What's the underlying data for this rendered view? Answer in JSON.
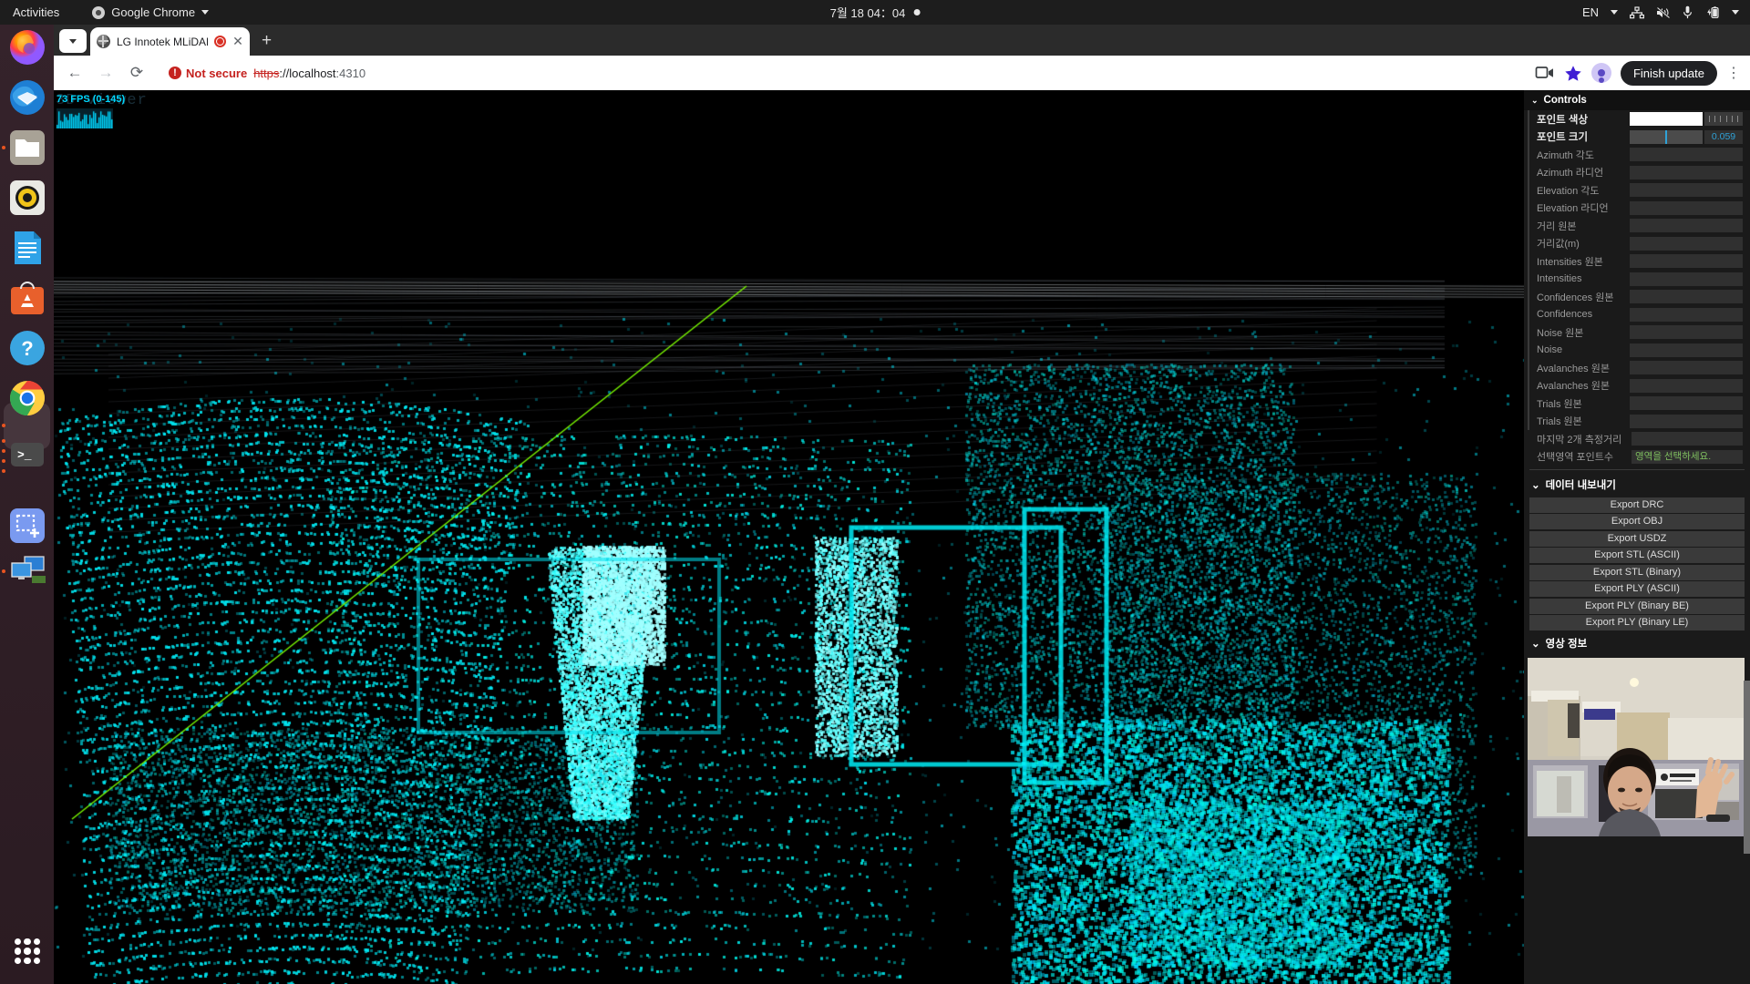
{
  "desktop": {
    "activities": "Activities",
    "app_menu": "Google Chrome",
    "clock": "7월 18  04：04",
    "tray": {
      "language": "EN"
    },
    "dock_items": [
      {
        "name": "firefox",
        "label": "Firefox"
      },
      {
        "name": "thunderbird",
        "label": "Thunderbird"
      },
      {
        "name": "files",
        "label": "Files"
      },
      {
        "name": "rhythmbox",
        "label": "Rhythmbox"
      },
      {
        "name": "libreoffice-writer",
        "label": "LibreOffice Writer"
      },
      {
        "name": "ubuntu-software",
        "label": "Ubuntu Software"
      },
      {
        "name": "help",
        "label": "Help"
      },
      {
        "name": "google-chrome",
        "label": "Google Chrome"
      },
      {
        "name": "terminal",
        "label": "Terminal"
      },
      {
        "name": "screenshot",
        "label": "Screenshot"
      },
      {
        "name": "displays",
        "label": "Displays"
      }
    ]
  },
  "browser": {
    "tab": {
      "title": "LG Innotek MLiDAR O",
      "close_label": "✕"
    },
    "new_tab_label": "+",
    "nav": {
      "back": "←",
      "forward": "→",
      "reload": "⟳"
    },
    "omnibox": {
      "security_text": "Not secure",
      "security_badge": "!",
      "url_scheme": "https",
      "url_sep": "://",
      "url_host": "localhost",
      "url_port": ":4310"
    },
    "finish_update_label": "Finish update",
    "kebab_label": "⋮"
  },
  "viewer": {
    "watermark": "3D viewer",
    "fps_text": "73 FPS (0-145)",
    "point_color": "#00e5ff",
    "axis_color": "#7cfc00",
    "background": "#000000"
  },
  "panel": {
    "controls_title": "Controls",
    "rows": [
      {
        "label": "포인트 색상",
        "type": "color",
        "value": "#ffffff"
      },
      {
        "label": "포인트 크기",
        "type": "slider",
        "value": "0.059"
      },
      {
        "label": "Azimuth 각도",
        "type": "field",
        "value": ""
      },
      {
        "label": "Azimuth 라디언",
        "type": "field",
        "value": ""
      },
      {
        "label": "Elevation 각도",
        "type": "field",
        "value": ""
      },
      {
        "label": "Elevation 라디언",
        "type": "field",
        "value": ""
      },
      {
        "label": "거리 원본",
        "type": "field",
        "value": ""
      },
      {
        "label": "거리값(m)",
        "type": "field",
        "value": ""
      },
      {
        "label": "Intensities 원본",
        "type": "field",
        "value": ""
      },
      {
        "label": "Intensities",
        "type": "field",
        "value": ""
      },
      {
        "label": "Confidences 원본",
        "type": "field",
        "value": ""
      },
      {
        "label": "Confidences",
        "type": "field",
        "value": ""
      },
      {
        "label": "Noise 원본",
        "type": "field",
        "value": ""
      },
      {
        "label": "Noise",
        "type": "field",
        "value": ""
      },
      {
        "label": "Avalanches 원본",
        "type": "field",
        "value": ""
      },
      {
        "label": "Avalanches 원본",
        "type": "field",
        "value": ""
      },
      {
        "label": "Trials 원본",
        "type": "field",
        "value": ""
      },
      {
        "label": "Trials 원본",
        "type": "field",
        "value": ""
      }
    ],
    "summary_rows": [
      {
        "label": "마지막 2개 측정거리",
        "value": "",
        "value_color": ""
      },
      {
        "label": "선택영역 포인트수",
        "value": "영역을 선택하세요.",
        "value_color": "#7fbf5f"
      }
    ],
    "export_section_title": "데이터 내보내기",
    "export_buttons": [
      "Export DRC",
      "Export OBJ",
      "Export USDZ",
      "Export STL (ASCII)",
      "Export STL (Binary)",
      "Export PLY (ASCII)",
      "Export PLY (Binary BE)",
      "Export PLY (Binary LE)"
    ],
    "video_section_title": "영상 정보"
  }
}
